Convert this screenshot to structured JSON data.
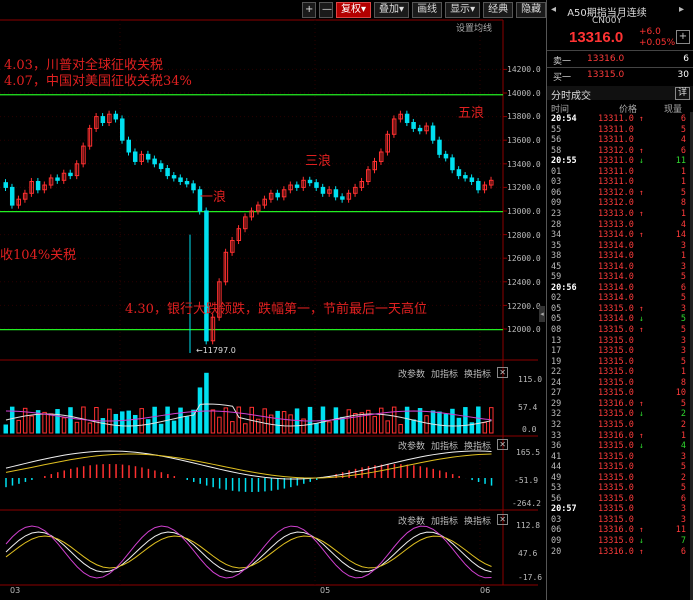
{
  "toolbar": {
    "buttons": [
      "+",
      "—",
      "复权",
      "叠加",
      "画线",
      "显示",
      "经典",
      "隐藏"
    ],
    "active": "复权",
    "dropdown_marks": [
      "▾",
      "▾",
      "▾"
    ],
    "avg_setting": "设置均线"
  },
  "main_chart": {
    "y_ticks": [
      "14200.0",
      "14000.0",
      "13800.0",
      "13600.0",
      "13400.0",
      "13200.0",
      "13000.0",
      "12800.0",
      "12600.0",
      "12400.0",
      "12200.0",
      "12000.0"
    ],
    "low_marker": "←11797.0",
    "annotations": {
      "line1": "4.03，川普对全球征收关税",
      "line2": "4.07，中国对美国征收关税34%",
      "line3": "收104%关税",
      "wave1": "一浪",
      "wave3": "三浪",
      "wave5": "五浪",
      "note": "4.30，银行大跌领跌，跌幅第一，节前最后一天高位"
    },
    "colors": {
      "up": "#ff3030",
      "down": "#00e0f0",
      "hline": "#22ee22"
    }
  },
  "indicator_headers": {
    "change_param": "改参数",
    "add_indicator": "加指标",
    "switch_indicator": "换指标",
    "close": "✕"
  },
  "vol_panel": {
    "y_ticks": [
      "115.0",
      "57.4",
      "0.0"
    ]
  },
  "macd_panel": {
    "y_ticks": [
      "165.5",
      "-51.9",
      "-264.2"
    ]
  },
  "kdj_panel": {
    "y_ticks": [
      "112.8",
      "47.6",
      "-17.6"
    ]
  },
  "x_labels": [
    "03",
    "05",
    "06"
  ],
  "quote": {
    "title": "A50期指当月连续",
    "code": "CN00Y",
    "price": "13316.0",
    "change": "+6.0",
    "change_pct": "+0.05%",
    "sell_label": "卖一",
    "sell_price": "13316.0",
    "sell_vol": "6",
    "buy_label": "买一",
    "buy_price": "13315.0",
    "buy_vol": "30",
    "tab": "分时成交",
    "detail": "详",
    "col_time": "时间",
    "col_price": "价格",
    "col_vol": "现量"
  },
  "trades": [
    {
      "t": "20:54",
      "p": "13311.0",
      "a": "↑",
      "v": "6",
      "c": "r"
    },
    {
      "t": "55",
      "p": "13311.0",
      "a": "",
      "v": "5",
      "c": "r"
    },
    {
      "t": "56",
      "p": "13311.0",
      "a": "",
      "v": "4",
      "c": "r"
    },
    {
      "t": "58",
      "p": "13312.0",
      "a": "↑",
      "v": "6",
      "c": "r"
    },
    {
      "t": "20:55",
      "p": "13311.0",
      "a": "↓",
      "v": "11",
      "c": "g"
    },
    {
      "t": "01",
      "p": "13311.0",
      "a": "",
      "v": "1",
      "c": "r"
    },
    {
      "t": "03",
      "p": "13311.0",
      "a": "",
      "v": "1",
      "c": "r"
    },
    {
      "t": "06",
      "p": "13312.0",
      "a": "↑",
      "v": "5",
      "c": "r"
    },
    {
      "t": "09",
      "p": "13312.0",
      "a": "",
      "v": "8",
      "c": "r"
    },
    {
      "t": "23",
      "p": "13313.0",
      "a": "↑",
      "v": "1",
      "c": "r"
    },
    {
      "t": "28",
      "p": "13313.0",
      "a": "",
      "v": "4",
      "c": "r"
    },
    {
      "t": "34",
      "p": "13314.0",
      "a": "↑",
      "v": "14",
      "c": "r"
    },
    {
      "t": "35",
      "p": "13314.0",
      "a": "",
      "v": "3",
      "c": "r"
    },
    {
      "t": "38",
      "p": "13314.0",
      "a": "",
      "v": "1",
      "c": "r"
    },
    {
      "t": "45",
      "p": "13314.0",
      "a": "",
      "v": "3",
      "c": "r"
    },
    {
      "t": "59",
      "p": "13314.0",
      "a": "",
      "v": "5",
      "c": "r"
    },
    {
      "t": "20:56",
      "p": "13314.0",
      "a": "",
      "v": "6",
      "c": "r"
    },
    {
      "t": "02",
      "p": "13314.0",
      "a": "",
      "v": "5",
      "c": "r"
    },
    {
      "t": "05",
      "p": "13315.0",
      "a": "↑",
      "v": "3",
      "c": "r"
    },
    {
      "t": "05",
      "p": "13314.0",
      "a": "↓",
      "v": "5",
      "c": "g"
    },
    {
      "t": "08",
      "p": "13315.0",
      "a": "↑",
      "v": "5",
      "c": "r"
    },
    {
      "t": "13",
      "p": "13315.0",
      "a": "",
      "v": "3",
      "c": "r"
    },
    {
      "t": "17",
      "p": "13315.0",
      "a": "",
      "v": "3",
      "c": "r"
    },
    {
      "t": "19",
      "p": "13315.0",
      "a": "",
      "v": "5",
      "c": "r"
    },
    {
      "t": "22",
      "p": "13315.0",
      "a": "",
      "v": "1",
      "c": "r"
    },
    {
      "t": "24",
      "p": "13315.0",
      "a": "",
      "v": "8",
      "c": "r"
    },
    {
      "t": "27",
      "p": "13315.0",
      "a": "",
      "v": "10",
      "c": "r"
    },
    {
      "t": "29",
      "p": "13316.0",
      "a": "↑",
      "v": "5",
      "c": "r"
    },
    {
      "t": "32",
      "p": "13315.0",
      "a": "↓",
      "v": "2",
      "c": "g"
    },
    {
      "t": "32",
      "p": "13315.0",
      "a": "",
      "v": "2",
      "c": "r"
    },
    {
      "t": "33",
      "p": "13316.0",
      "a": "↑",
      "v": "1",
      "c": "r"
    },
    {
      "t": "36",
      "p": "13315.0",
      "a": "↓",
      "v": "4",
      "c": "g"
    },
    {
      "t": "41",
      "p": "13315.0",
      "a": "",
      "v": "3",
      "c": "r"
    },
    {
      "t": "44",
      "p": "13315.0",
      "a": "",
      "v": "5",
      "c": "r"
    },
    {
      "t": "49",
      "p": "13315.0",
      "a": "",
      "v": "2",
      "c": "r"
    },
    {
      "t": "53",
      "p": "13315.0",
      "a": "",
      "v": "5",
      "c": "r"
    },
    {
      "t": "56",
      "p": "13315.0",
      "a": "",
      "v": "6",
      "c": "r"
    },
    {
      "t": "20:57",
      "p": "13315.0",
      "a": "",
      "v": "3",
      "c": "r"
    },
    {
      "t": "03",
      "p": "13315.0",
      "a": "",
      "v": "3",
      "c": "r"
    },
    {
      "t": "06",
      "p": "13316.0",
      "a": "↑",
      "v": "11",
      "c": "r"
    },
    {
      "t": "09",
      "p": "13315.0",
      "a": "↓",
      "v": "7",
      "c": "g"
    },
    {
      "t": "20",
      "p": "13316.0",
      "a": "↑",
      "v": "6",
      "c": "r"
    }
  ]
}
